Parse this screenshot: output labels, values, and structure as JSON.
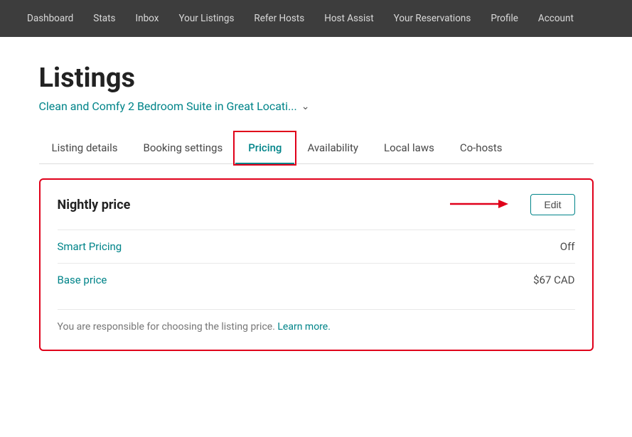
{
  "nav": {
    "items": [
      {
        "label": "Dashboard",
        "id": "dashboard"
      },
      {
        "label": "Stats",
        "id": "stats"
      },
      {
        "label": "Inbox",
        "id": "inbox"
      },
      {
        "label": "Your Listings",
        "id": "your-listings"
      },
      {
        "label": "Refer Hosts",
        "id": "refer-hosts"
      },
      {
        "label": "Host Assist",
        "id": "host-assist"
      },
      {
        "label": "Your Reservations",
        "id": "your-reservations"
      },
      {
        "label": "Profile",
        "id": "profile"
      },
      {
        "label": "Account",
        "id": "account"
      }
    ]
  },
  "page": {
    "title": "Listings",
    "listing_name": "Clean and Comfy 2 Bedroom Suite in Great Locati...",
    "tabs": [
      {
        "label": "Listing details",
        "id": "listing-details",
        "active": false
      },
      {
        "label": "Booking settings",
        "id": "booking-settings",
        "active": false
      },
      {
        "label": "Pricing",
        "id": "pricing",
        "active": true
      },
      {
        "label": "Availability",
        "id": "availability",
        "active": false
      },
      {
        "label": "Local laws",
        "id": "local-laws",
        "active": false
      },
      {
        "label": "Co-hosts",
        "id": "co-hosts",
        "active": false
      }
    ]
  },
  "nightly_price_section": {
    "title": "Nightly price",
    "edit_label": "Edit",
    "rows": [
      {
        "label": "Smart Pricing",
        "value": "Off",
        "id": "smart-pricing"
      },
      {
        "label": "Base price",
        "value": "$67 CAD",
        "id": "base-price"
      }
    ],
    "footer": {
      "text_before_link": "You are responsible for choosing the listing price.",
      "link_text": "Learn more.",
      "text_after_link": ""
    }
  }
}
